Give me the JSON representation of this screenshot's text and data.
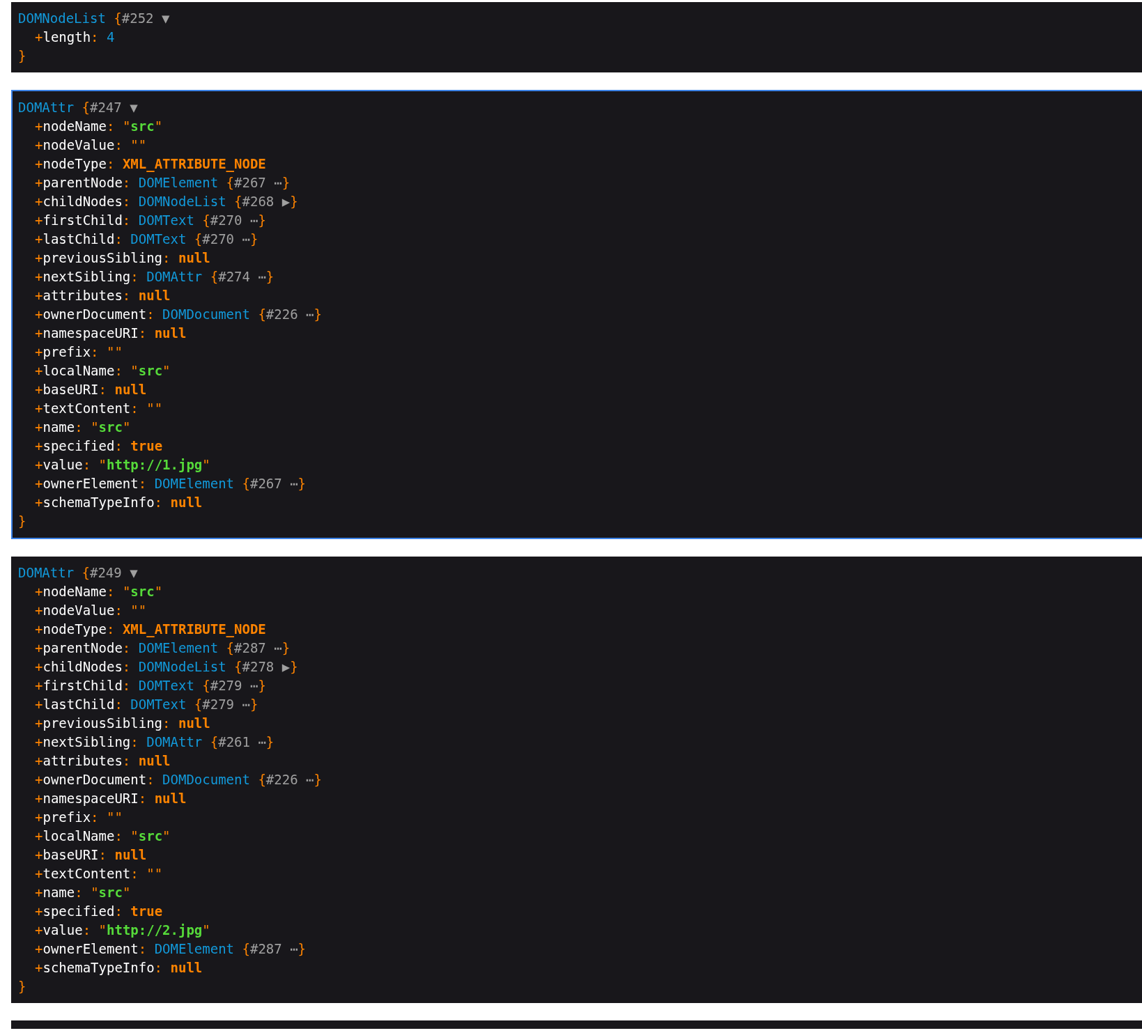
{
  "dumps": [
    {
      "class": "DOMNodeList",
      "ref": "{#252 ▼",
      "selected": false,
      "close": "}",
      "props": [
        {
          "key": "+length:",
          "kind": "number",
          "value": "4"
        }
      ]
    },
    {
      "class": "DOMAttr",
      "ref": "{#247 ▼",
      "selected": true,
      "close": "}",
      "props": [
        {
          "key": "+nodeName:",
          "kind": "string",
          "value": "\"src\""
        },
        {
          "key": "+nodeValue:",
          "kind": "string",
          "value": "\"\""
        },
        {
          "key": "+nodeType:",
          "kind": "const",
          "value": "XML_ATTRIBUTE_NODE"
        },
        {
          "key": "+parentNode:",
          "kind": "object",
          "class": "DOMElement",
          "ref": "{#267 ⋯}"
        },
        {
          "key": "+childNodes:",
          "kind": "object",
          "class": "DOMNodeList",
          "ref": "{#268 ▶}"
        },
        {
          "key": "+firstChild:",
          "kind": "object",
          "class": "DOMText",
          "ref": "{#270 ⋯}"
        },
        {
          "key": "+lastChild:",
          "kind": "object",
          "class": "DOMText",
          "ref": "{#270 ⋯}"
        },
        {
          "key": "+previousSibling:",
          "kind": "const",
          "value": "null"
        },
        {
          "key": "+nextSibling:",
          "kind": "object",
          "class": "DOMAttr",
          "ref": "{#274 ⋯}"
        },
        {
          "key": "+attributes:",
          "kind": "const",
          "value": "null"
        },
        {
          "key": "+ownerDocument:",
          "kind": "object",
          "class": "DOMDocument",
          "ref": "{#226 ⋯}"
        },
        {
          "key": "+namespaceURI:",
          "kind": "const",
          "value": "null"
        },
        {
          "key": "+prefix:",
          "kind": "string",
          "value": "\"\""
        },
        {
          "key": "+localName:",
          "kind": "string",
          "value": "\"src\""
        },
        {
          "key": "+baseURI:",
          "kind": "const",
          "value": "null"
        },
        {
          "key": "+textContent:",
          "kind": "string",
          "value": "\"\""
        },
        {
          "key": "+name:",
          "kind": "string",
          "value": "\"src\""
        },
        {
          "key": "+specified:",
          "kind": "const",
          "value": "true"
        },
        {
          "key": "+value:",
          "kind": "string",
          "value": "\"http://1.jpg\""
        },
        {
          "key": "+ownerElement:",
          "kind": "object",
          "class": "DOMElement",
          "ref": "{#267 ⋯}"
        },
        {
          "key": "+schemaTypeInfo:",
          "kind": "const",
          "value": "null"
        }
      ]
    },
    {
      "class": "DOMAttr",
      "ref": "{#249 ▼",
      "selected": false,
      "close": "}",
      "props": [
        {
          "key": "+nodeName:",
          "kind": "string",
          "value": "\"src\""
        },
        {
          "key": "+nodeValue:",
          "kind": "string",
          "value": "\"\""
        },
        {
          "key": "+nodeType:",
          "kind": "const",
          "value": "XML_ATTRIBUTE_NODE"
        },
        {
          "key": "+parentNode:",
          "kind": "object",
          "class": "DOMElement",
          "ref": "{#287 ⋯}"
        },
        {
          "key": "+childNodes:",
          "kind": "object",
          "class": "DOMNodeList",
          "ref": "{#278 ▶}"
        },
        {
          "key": "+firstChild:",
          "kind": "object",
          "class": "DOMText",
          "ref": "{#279 ⋯}"
        },
        {
          "key": "+lastChild:",
          "kind": "object",
          "class": "DOMText",
          "ref": "{#279 ⋯}"
        },
        {
          "key": "+previousSibling:",
          "kind": "const",
          "value": "null"
        },
        {
          "key": "+nextSibling:",
          "kind": "object",
          "class": "DOMAttr",
          "ref": "{#261 ⋯}"
        },
        {
          "key": "+attributes:",
          "kind": "const",
          "value": "null"
        },
        {
          "key": "+ownerDocument:",
          "kind": "object",
          "class": "DOMDocument",
          "ref": "{#226 ⋯}"
        },
        {
          "key": "+namespaceURI:",
          "kind": "const",
          "value": "null"
        },
        {
          "key": "+prefix:",
          "kind": "string",
          "value": "\"\""
        },
        {
          "key": "+localName:",
          "kind": "string",
          "value": "\"src\""
        },
        {
          "key": "+baseURI:",
          "kind": "const",
          "value": "null"
        },
        {
          "key": "+textContent:",
          "kind": "string",
          "value": "\"\""
        },
        {
          "key": "+name:",
          "kind": "string",
          "value": "\"src\""
        },
        {
          "key": "+specified:",
          "kind": "const",
          "value": "true"
        },
        {
          "key": "+value:",
          "kind": "string",
          "value": "\"http://2.jpg\""
        },
        {
          "key": "+ownerElement:",
          "kind": "object",
          "class": "DOMElement",
          "ref": "{#287 ⋯}"
        },
        {
          "key": "+schemaTypeInfo:",
          "kind": "const",
          "value": "null"
        }
      ]
    }
  ]
}
